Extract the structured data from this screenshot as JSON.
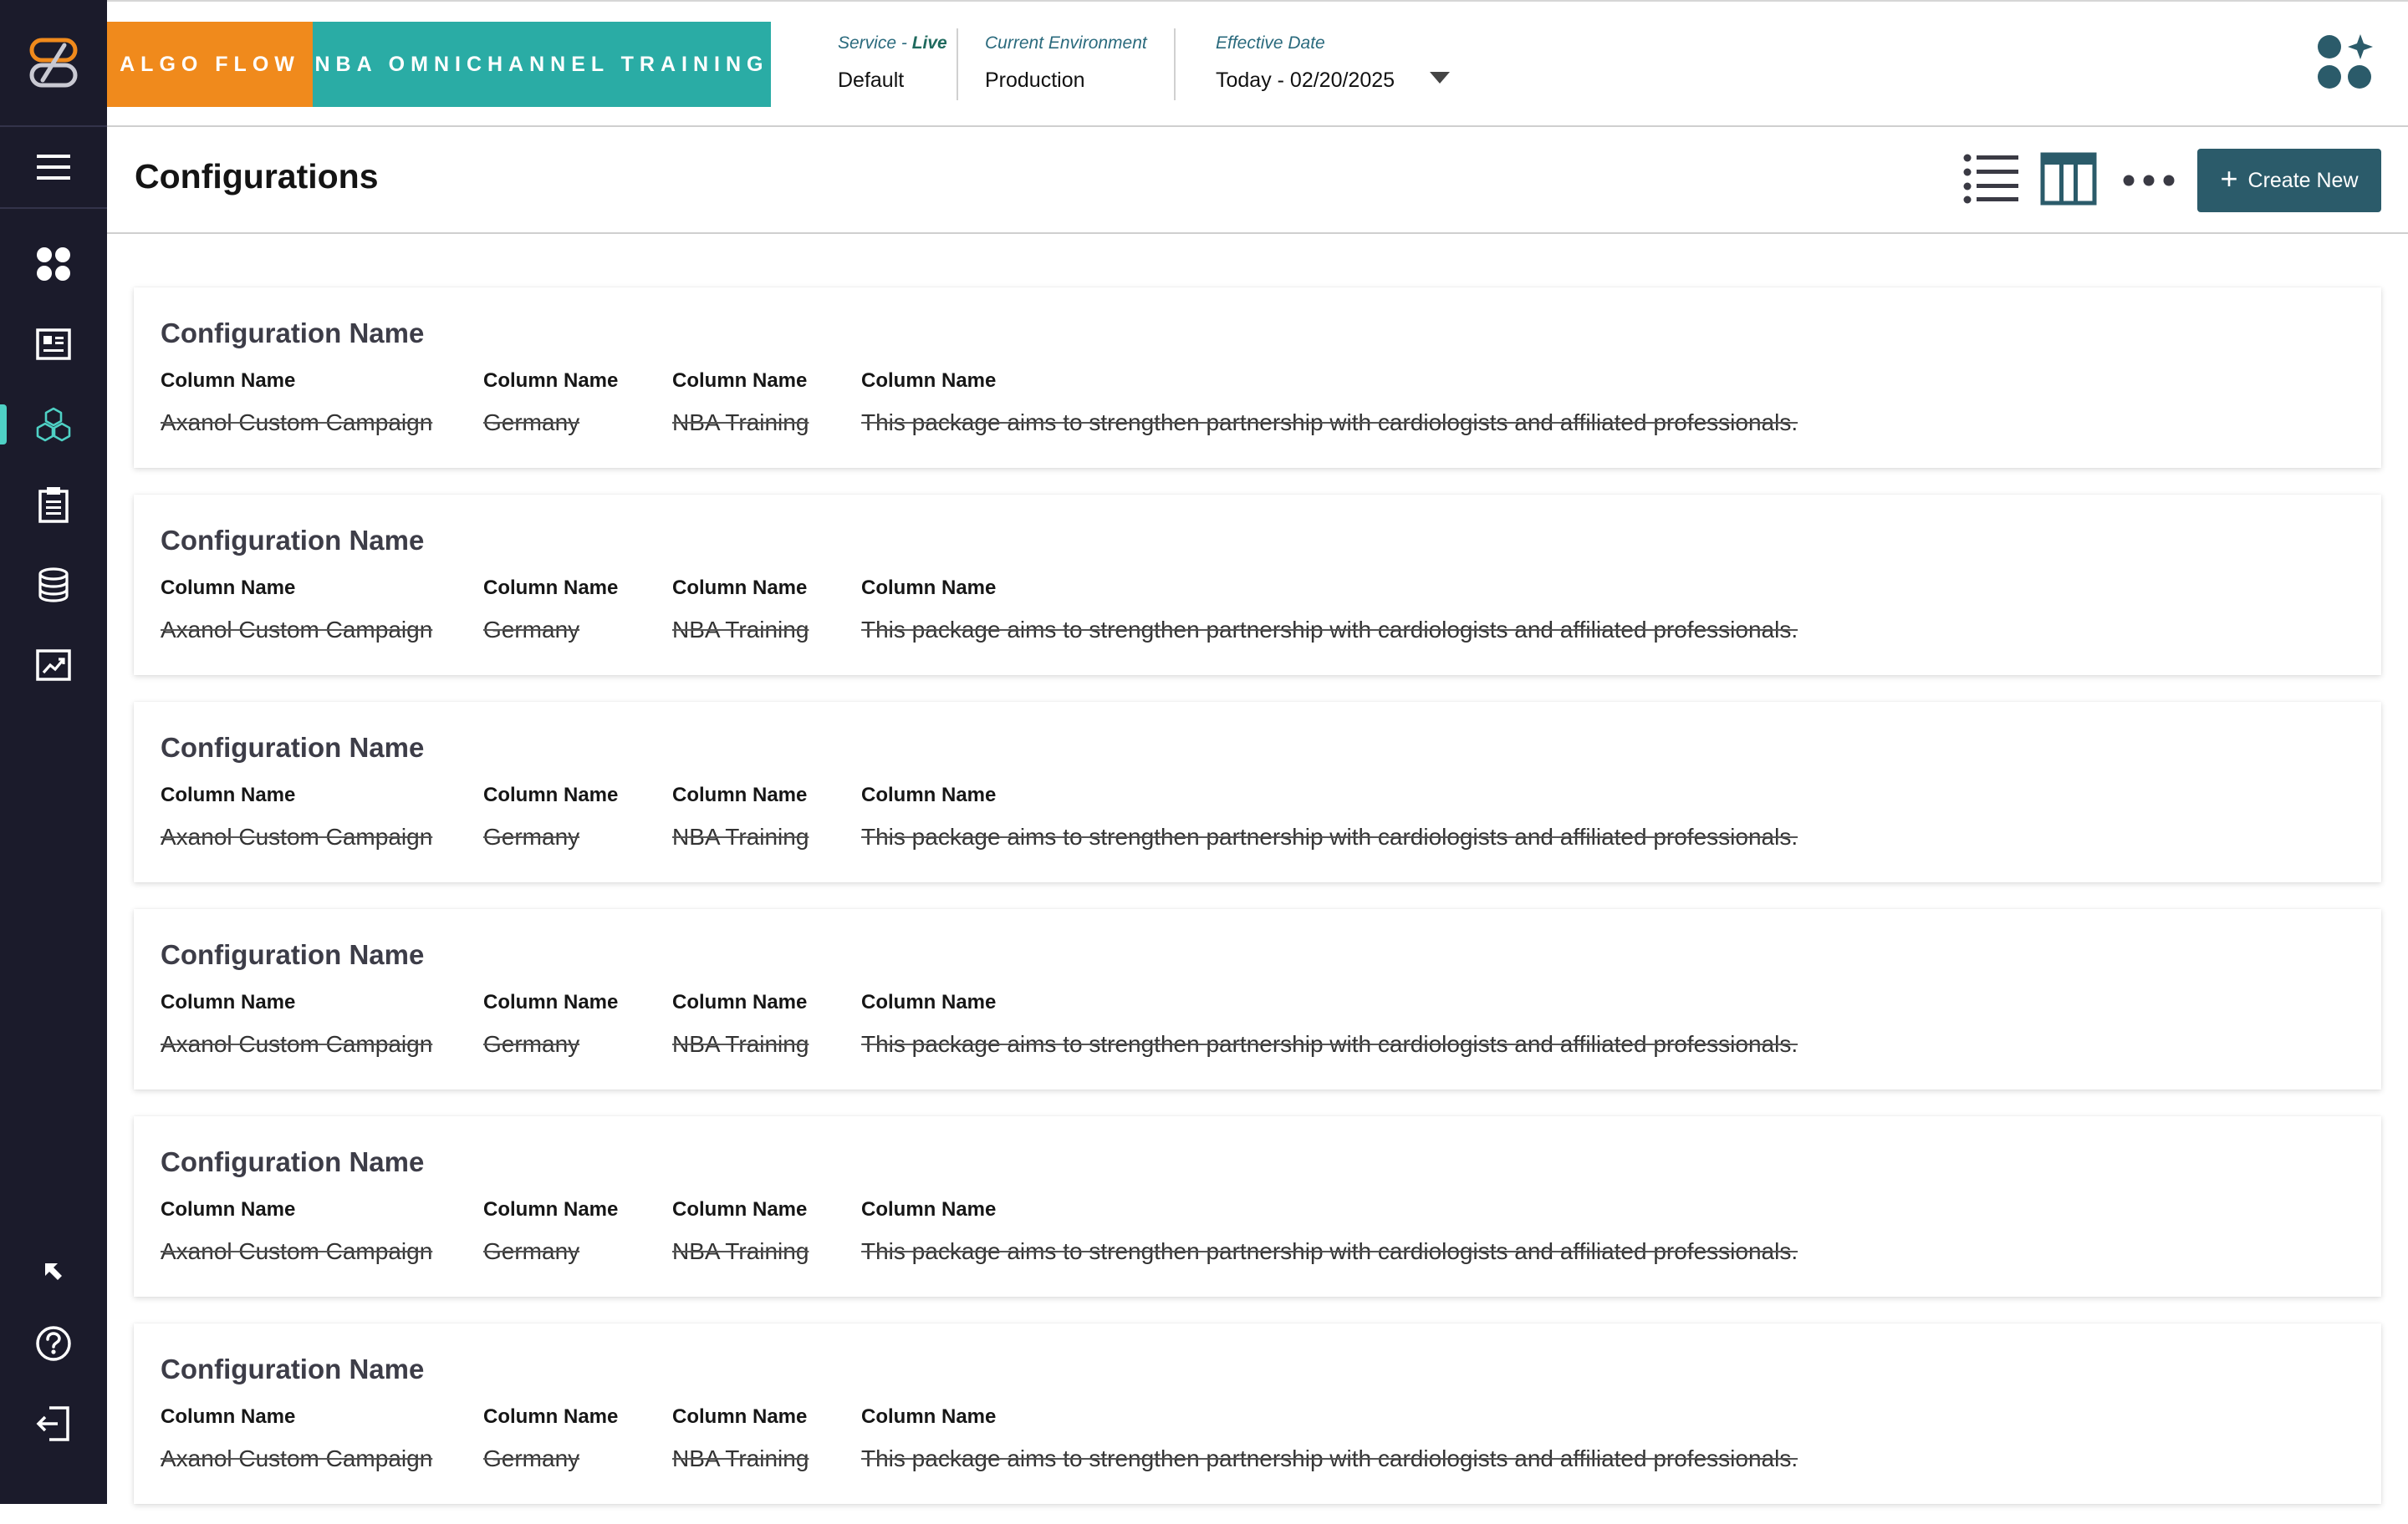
{
  "brand": {
    "primary": "ALGO FLOW",
    "secondary": "NBA OMNICHANNEL TRAINING"
  },
  "header": {
    "service_label": "Service - ",
    "service_live": "Live",
    "service_value": "Default",
    "environment_label": "Current Environment",
    "environment_value": "Production",
    "date_label": "Effective Date",
    "date_value": "Today - 02/20/2025"
  },
  "page": {
    "title": "Configurations",
    "create_label": "Create New"
  },
  "sidebar": {
    "items": [
      {
        "icon": "dashboard-grid-icon",
        "active": false
      },
      {
        "icon": "newspaper-icon",
        "active": false
      },
      {
        "icon": "cubes-icon",
        "active": true
      },
      {
        "icon": "clipboard-icon",
        "active": false
      },
      {
        "icon": "database-icon",
        "active": false
      },
      {
        "icon": "chart-icon",
        "active": false
      }
    ],
    "bottom": [
      "collapse-icon",
      "help-icon",
      "logout-icon"
    ]
  },
  "cards": [
    {
      "title": "Configuration Name",
      "columns": [
        {
          "header": "Column Name",
          "value": "Axanol Custom Campaign"
        },
        {
          "header": "Column Name",
          "value": "Germany"
        },
        {
          "header": "Column Name",
          "value": "NBA Training"
        },
        {
          "header": "Column Name",
          "value": "This package aims to strengthen partnership with cardiologists and affiliated professionals."
        }
      ]
    },
    {
      "title": "Configuration Name",
      "columns": [
        {
          "header": "Column Name",
          "value": "Axanol Custom Campaign"
        },
        {
          "header": "Column Name",
          "value": "Germany"
        },
        {
          "header": "Column Name",
          "value": "NBA Training"
        },
        {
          "header": "Column Name",
          "value": "This package aims to strengthen partnership with cardiologists and affiliated professionals."
        }
      ]
    },
    {
      "title": "Configuration Name",
      "columns": [
        {
          "header": "Column Name",
          "value": "Axanol Custom Campaign"
        },
        {
          "header": "Column Name",
          "value": "Germany"
        },
        {
          "header": "Column Name",
          "value": "NBA Training"
        },
        {
          "header": "Column Name",
          "value": "This package aims to strengthen partnership with cardiologists and affiliated professionals."
        }
      ]
    },
    {
      "title": "Configuration Name",
      "columns": [
        {
          "header": "Column Name",
          "value": "Axanol Custom Campaign"
        },
        {
          "header": "Column Name",
          "value": "Germany"
        },
        {
          "header": "Column Name",
          "value": "NBA Training"
        },
        {
          "header": "Column Name",
          "value": "This package aims to strengthen partnership with cardiologists and affiliated professionals."
        }
      ]
    },
    {
      "title": "Configuration Name",
      "columns": [
        {
          "header": "Column Name",
          "value": "Axanol Custom Campaign"
        },
        {
          "header": "Column Name",
          "value": "Germany"
        },
        {
          "header": "Column Name",
          "value": "NBA Training"
        },
        {
          "header": "Column Name",
          "value": "This package aims to strengthen partnership with cardiologists and affiliated professionals."
        }
      ]
    },
    {
      "title": "Configuration Name",
      "columns": [
        {
          "header": "Column Name",
          "value": "Axanol Custom Campaign"
        },
        {
          "header": "Column Name",
          "value": "Germany"
        },
        {
          "header": "Column Name",
          "value": "NBA Training"
        },
        {
          "header": "Column Name",
          "value": "This package aims to strengthen partnership with cardiologists and affiliated professionals."
        }
      ]
    }
  ],
  "colors": {
    "sidebar_bg": "#1b1b2b",
    "brand_orange": "#f08a1c",
    "brand_teal": "#2aaca5",
    "button_bg": "#2b5b6a",
    "active_indicator": "#4fd1c5"
  }
}
